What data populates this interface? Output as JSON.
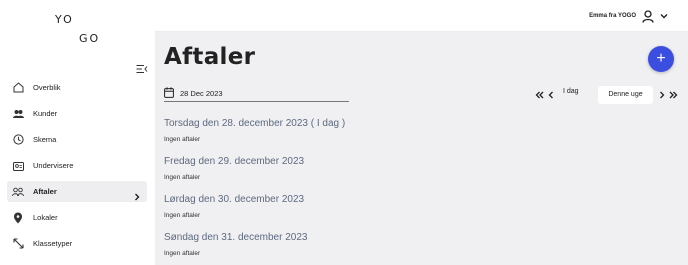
{
  "logo": {
    "line1": "YO",
    "line2": "GO"
  },
  "user": {
    "name": "Emma fra YOGO"
  },
  "sidebar": {
    "items": [
      {
        "label": "Overblik",
        "icon": "home-icon"
      },
      {
        "label": "Kunder",
        "icon": "users-icon"
      },
      {
        "label": "Skema",
        "icon": "clock-icon"
      },
      {
        "label": "Undervisere",
        "icon": "id-card-icon"
      },
      {
        "label": "Aftaler",
        "icon": "people-icon",
        "active": true
      },
      {
        "label": "Lokaler",
        "icon": "location-pin-icon"
      },
      {
        "label": "Klassetyper",
        "icon": "expand-arrows-icon"
      }
    ]
  },
  "main": {
    "title": "Aftaler",
    "fab_label": "+",
    "date_value": "28 Dec 2023",
    "today_label": "I dag",
    "week_label": "Denne uge",
    "days": [
      {
        "heading": "Torsdag den 28. december 2023 ( I dag )",
        "note": "Ingen aftaler"
      },
      {
        "heading": "Fredag den 29. december 2023",
        "note": "Ingen aftaler"
      },
      {
        "heading": "Lørdag den 30. december 2023",
        "note": "Ingen aftaler"
      },
      {
        "heading": "Søndag den 31. december 2023",
        "note": "Ingen aftaler"
      }
    ]
  },
  "colors": {
    "accent": "#3c4ee0",
    "main_bg": "#f0f0f3",
    "heading": "#5d6a7e"
  }
}
